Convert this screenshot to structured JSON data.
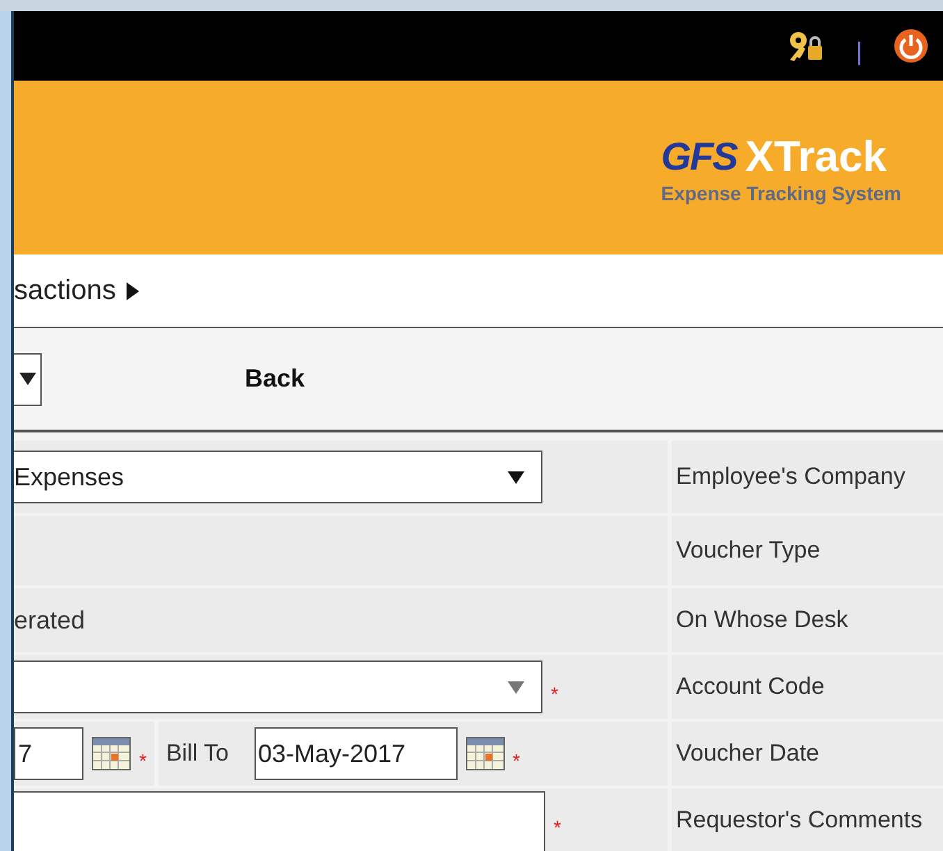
{
  "top_bar": {
    "separator": "|"
  },
  "header": {
    "logo_mark": "GFS",
    "logo_title": "XTrack",
    "logo_subtitle": "Expense Tracking System"
  },
  "breadcrumb": {
    "text": "sactions"
  },
  "toolbar": {
    "back": "Back"
  },
  "form_rows": [
    {
      "kind": "select",
      "value": "Expenses",
      "label": "Employee's Company"
    },
    {
      "kind": "empty",
      "label": "Voucher Type"
    },
    {
      "kind": "text",
      "value": "erated",
      "label": "On Whose Desk"
    },
    {
      "kind": "select",
      "label": "Account Code",
      "required_mark": "*"
    },
    {
      "kind": "dates",
      "from": "7",
      "from_required_mark": "*",
      "bill_to_label": "Bill To",
      "to": "03-May-2017",
      "to_required_mark": "*",
      "label": "Voucher Date"
    },
    {
      "kind": "textarea",
      "label": "Requestor's Comments",
      "required_mark": "*"
    }
  ]
}
